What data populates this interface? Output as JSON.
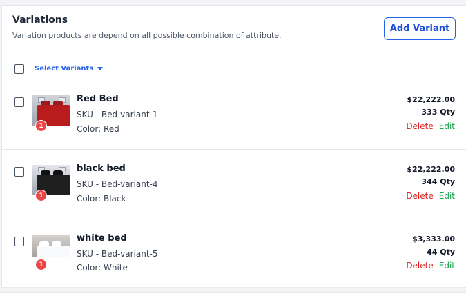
{
  "header": {
    "title": "Variations",
    "subtitle": "Variation products are depend on all possible combination of attribute.",
    "add_button": "Add Variant"
  },
  "select_variants": "Select Variants",
  "variants": [
    {
      "name": "Red Bed",
      "sku": "SKU - Bed-variant-1",
      "color_label": "Color: Red",
      "price": "$22,222.00",
      "qty": "333 Qty",
      "badge": "1",
      "delete": "Delete",
      "edit": "Edit",
      "thumb_color": "#b91c1c"
    },
    {
      "name": "black bed",
      "sku": "SKU - Bed-variant-4",
      "color_label": "Color: Black",
      "price": "$22,222.00",
      "qty": "344 Qty",
      "badge": "1",
      "delete": "Delete",
      "edit": "Edit",
      "thumb_color": "#1f1f1f"
    },
    {
      "name": "white bed",
      "sku": "SKU - Bed-variant-5",
      "color_label": "Color: White",
      "price": "$3,333.00",
      "qty": "44 Qty",
      "badge": "1",
      "delete": "Delete",
      "edit": "Edit",
      "thumb_color": "#f3f4f6"
    }
  ],
  "colors": {
    "accent": "#2563eb",
    "delete": "#dc2626",
    "edit": "#16a34a",
    "badge": "#ef4444"
  }
}
